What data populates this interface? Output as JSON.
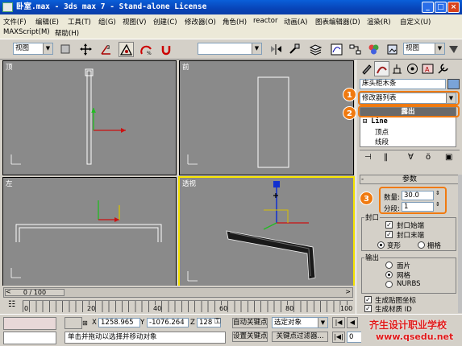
{
  "window": {
    "title": "卧室.max - 3ds max 7 - Stand-alone License",
    "buttons": [
      "_",
      "□",
      "×"
    ]
  },
  "menu": {
    "row1": [
      "文件(F)",
      "编辑(E)",
      "工具(T)",
      "组(G)",
      "视图(V)",
      "创建(C)",
      "修改器(O)",
      "角色(H)",
      "reactor",
      "动画(A)",
      "图表编辑器(D)",
      "渲染(R)",
      "自定义(U)"
    ],
    "row2": [
      "MAXScript(M)",
      "帮助(H)"
    ]
  },
  "toolbar": {
    "view_combo": "视图",
    "right_combo": "视图"
  },
  "viewports": {
    "top": "顶",
    "front": "前",
    "left": "左",
    "perspective": "透视"
  },
  "cmd": {
    "object_name": "床头柜木条",
    "modifier_list": "修改器列表",
    "stack_rollout": "露出",
    "stack_items": [
      "Line",
      "顶点",
      "线段"
    ],
    "params_title": "参数",
    "steps_label": "数量:",
    "steps_value": "30.0",
    "segments_label": "分段:",
    "segments_value": "1",
    "capping_title": "封口",
    "cap_start": "封口始端",
    "cap_end": "封口末端",
    "morph": "变形",
    "grid": "栅格",
    "output_title": "输出",
    "out_patch": "面片",
    "out_mesh": "网格",
    "out_nurbs": "NURBS",
    "gen_map": "生成贴图坐标",
    "gen_mat": "生成材质 ID",
    "markers": [
      "1",
      "2",
      "3"
    ]
  },
  "timeline": {
    "frame": "0 / 100",
    "ticks": [
      "0",
      "20",
      "40",
      "60",
      "80",
      "100"
    ]
  },
  "status": {
    "prompt": "单击并拖动以选择并移动对象",
    "x_label": "X",
    "x_value": "1258.965",
    "y_label": "Y",
    "y_value": "-1076.264",
    "z_label": "Z",
    "z_value": "128",
    "auto_key": "自动关键点",
    "set_key": "设置关键点",
    "selected": "选定对象",
    "key_filter": "关键点过滤器...",
    "frame_field": "0"
  },
  "watermark": {
    "line1": "齐生设计职业学校",
    "line2": "www.qsedu.net"
  }
}
